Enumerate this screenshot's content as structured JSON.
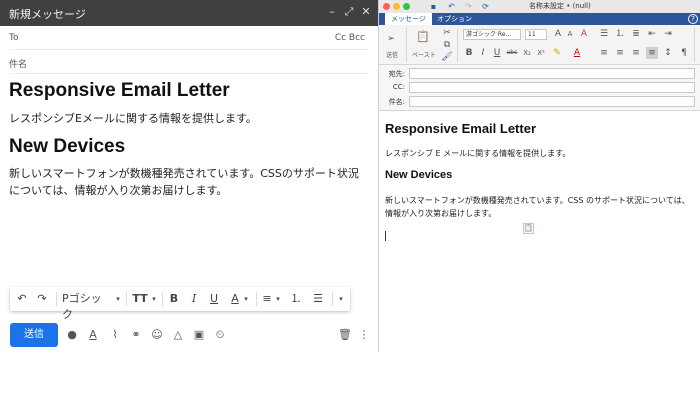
{
  "gmail": {
    "window_title": "新規メッセージ",
    "to_label": "To",
    "ccbcc_label": "Cc Bcc",
    "subject_placeholder": "件名",
    "heading1": "Responsive Email Letter",
    "paragraph1": "レスポンシブEメールに関する情報を提供します。",
    "heading2": "New Devices",
    "paragraph2": "新しいスマートフォンが数機種発売されています。CSSのサポート状況については、情報が入り次第お届けします。",
    "format_toolbar": {
      "font_name": "Pゴシック"
    },
    "send_label": "送信"
  },
  "outlook": {
    "window_title": "名称未設定 • (null)",
    "tabs": [
      "メッセージ",
      "オプション"
    ],
    "ribbon": {
      "send_label": "送信",
      "paste_label": "ペースト",
      "font_name": "游ゴシック Re...",
      "font_size": "11"
    },
    "header_fields": {
      "to_label": "宛先:",
      "cc_label": "CC:",
      "subject_label": "件名:"
    },
    "heading1": "Responsive Email Letter",
    "paragraph1": "レスポンシブ E メールに関する情報を提供します。",
    "heading2": "New Devices",
    "paragraph2": "新しいスマートフォンが数機種発売されています。CSS のサポート状況については、情報が入り次第お届けします。"
  },
  "colors": {
    "gmail_header": "#404040",
    "send_button": "#1a73e8",
    "outlook_tabbar": "#2b579a"
  }
}
